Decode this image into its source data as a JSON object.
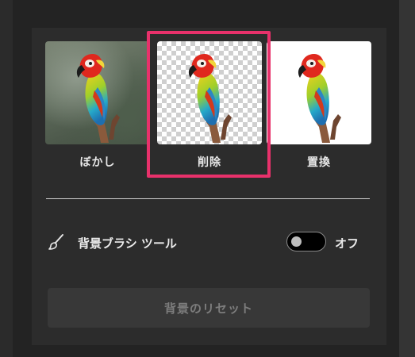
{
  "background_options": [
    {
      "label": "ぼかし",
      "image": "parrot-photo-blurred-background",
      "selected": false
    },
    {
      "label": "削除",
      "image": "parrot-photo-transparent-background",
      "selected": true
    },
    {
      "label": "置換",
      "image": "parrot-photo-white-background",
      "selected": false
    }
  ],
  "brush_tool": {
    "icon": "brush-icon",
    "label": "背景ブラシ ツール",
    "toggle_on": false,
    "state_label": "オフ"
  },
  "reset_button": {
    "label": "背景のリセット",
    "enabled": false
  },
  "colors": {
    "selection_accent": "#e8316b",
    "panel_bg": "#2c2c2c",
    "app_bg": "#232323"
  }
}
